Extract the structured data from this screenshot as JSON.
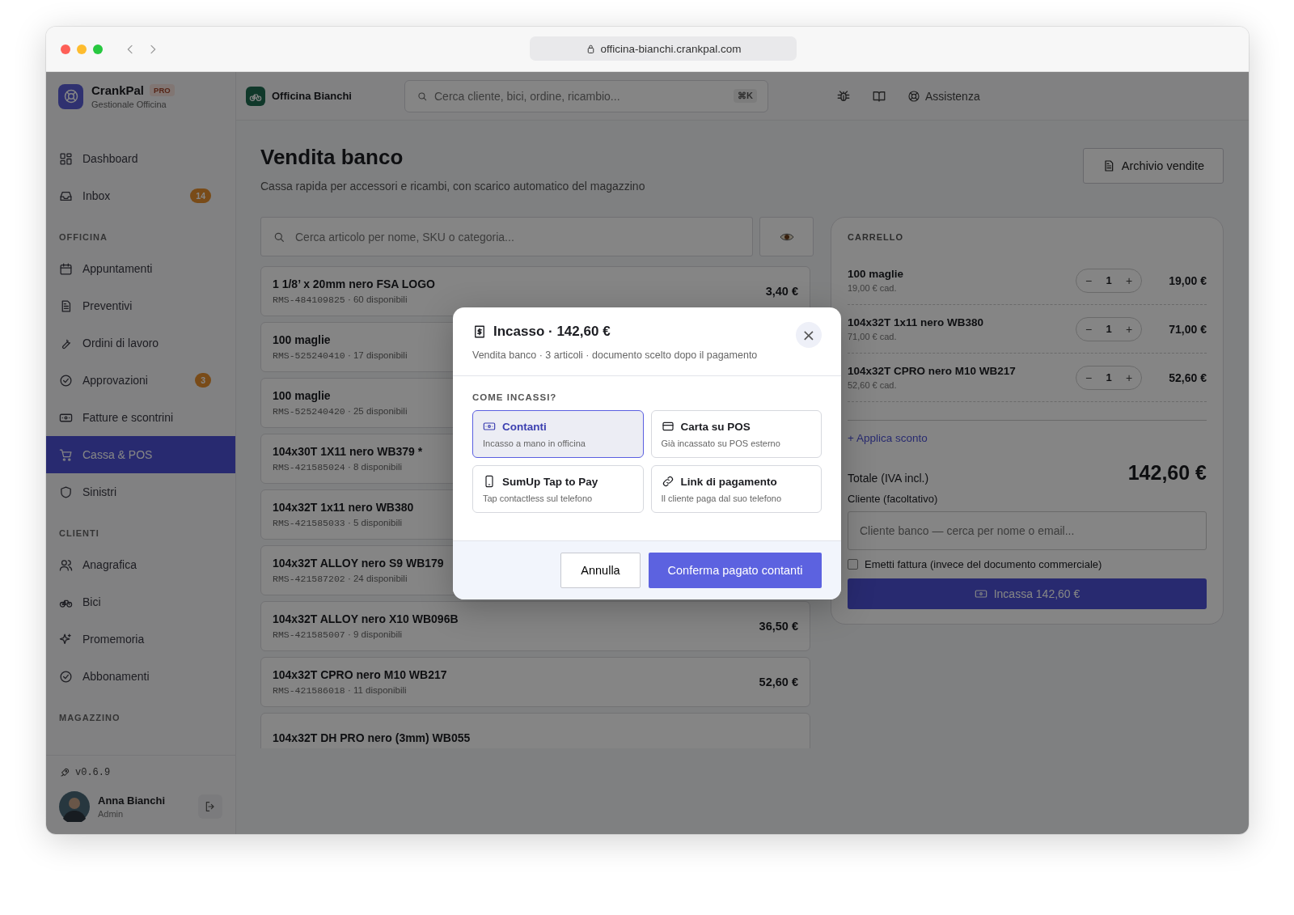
{
  "browser": {
    "url": "officina-bianchi.crankpal.com"
  },
  "brand": {
    "name": "CrankPal",
    "badge": "PRO",
    "subtitle": "Gestionale Officina"
  },
  "header": {
    "workshop": "Officina Bianchi",
    "search_placeholder": "Cerca cliente, bici, ordine, ricambio...",
    "shortcut": "⌘K",
    "help": "Assistenza"
  },
  "sidebar": {
    "sections": [
      {
        "items": [
          {
            "label": "Dashboard",
            "selected": false
          },
          {
            "label": "Inbox",
            "badge": "14",
            "selected": false
          }
        ]
      },
      {
        "title": "OFFICINA",
        "items": [
          {
            "label": "Appuntamenti",
            "selected": false
          },
          {
            "label": "Preventivi",
            "selected": false
          },
          {
            "label": "Ordini di lavoro",
            "selected": false
          },
          {
            "label": "Approvazioni",
            "badge": "3",
            "selected": false
          },
          {
            "label": "Fatture e scontrini",
            "selected": false
          },
          {
            "label": "Cassa & POS",
            "selected": true
          },
          {
            "label": "Sinistri",
            "selected": false
          }
        ]
      },
      {
        "title": "CLIENTI",
        "items": [
          {
            "label": "Anagrafica",
            "selected": false
          },
          {
            "label": "Bici",
            "selected": false
          },
          {
            "label": "Promemoria",
            "selected": false
          },
          {
            "label": "Abbonamenti",
            "selected": false
          }
        ]
      },
      {
        "title": "MAGAZZINO"
      }
    ],
    "version": "v0.6.9",
    "user": {
      "name": "Anna Bianchi",
      "role": "Admin"
    }
  },
  "page": {
    "title": "Vendita banco",
    "subtitle": "Cassa rapida per accessori e ricambi, con scarico automatico del magazzino",
    "archive_button": "Archivio vendite",
    "search_placeholder": "Cerca articolo per nome, SKU o categoria..."
  },
  "products": [
    {
      "name": "1 1/8’ x 20mm nero FSA LOGO",
      "sku": "RMS-484109825",
      "stock": "· 60 disponibili",
      "price": "3,40 €"
    },
    {
      "name": "100 maglie",
      "sku": "RMS-525240410",
      "stock": "· 17 disponibili"
    },
    {
      "name": "100 maglie",
      "sku": "RMS-525240420",
      "stock": "· 25 disponibili"
    },
    {
      "name": "104x30T 1X11 nero WB379 *",
      "sku": "RMS-421585024",
      "stock": "· 8 disponibili"
    },
    {
      "name": "104x32T 1x11 nero WB380",
      "sku": "RMS-421585033",
      "stock": "· 5 disponibili"
    },
    {
      "name": "104x32T ALLOY nero S9 WB179",
      "sku": "RMS-421587202",
      "stock": "· 24 disponibili"
    },
    {
      "name": "104x32T ALLOY nero X10 WB096B",
      "sku": "RMS-421585007",
      "stock": "· 9 disponibili",
      "price": "36,50 €"
    },
    {
      "name": "104x32T CPRO nero M10 WB217",
      "sku": "RMS-421586018",
      "stock": "· 11 disponibili",
      "price": "52,60 €"
    },
    {
      "name": "104x32T DH PRO nero (3mm) WB055"
    }
  ],
  "cart": {
    "title": "CARRELLO",
    "items": [
      {
        "name": "100 maglie",
        "unit": "19,00 € cad.",
        "minus": "−",
        "qty": "1",
        "plus": "+",
        "total": "19,00 €"
      },
      {
        "name": "104x32T 1x11 nero WB380",
        "unit": "71,00 € cad.",
        "minus": "−",
        "qty": "1",
        "plus": "+",
        "total": "71,00 €"
      },
      {
        "name": "104x32T CPRO nero M10 WB217",
        "unit": "52,60 € cad.",
        "minus": "−",
        "qty": "1",
        "plus": "+",
        "total": "52,60 €"
      }
    ],
    "discount_link": "+ Applica sconto",
    "total_label": "Totale (IVA incl.)",
    "total": "142,60 €",
    "customer_label": "Cliente (facoltativo)",
    "customer_placeholder": "Cliente banco — cerca per nome o email...",
    "invoice": {
      "label": "Emetti fattura (invece del documento commerciale)",
      "checked": false
    },
    "pay_button": "Incassa 142,60 €"
  },
  "dialog": {
    "title": "Incasso · 142,60 €",
    "subtitle": "Vendita banco · 3 articoli · documento scelto dopo il pagamento",
    "close": "×",
    "question": "COME INCASSI?",
    "options": [
      {
        "title": "Contanti",
        "subtitle": "Incasso a mano in officina",
        "selected": true
      },
      {
        "title": "Carta su POS",
        "subtitle": "Già incassato su POS esterno",
        "selected": false
      },
      {
        "title": "SumUp Tap to Pay",
        "subtitle": "Tap contactless sul telefono",
        "selected": false
      },
      {
        "title": "Link di pagamento",
        "subtitle": "Il cliente paga dal suo telefono",
        "selected": false
      }
    ],
    "cancel": "Annulla",
    "confirm": "Conferma pagato contanti"
  }
}
